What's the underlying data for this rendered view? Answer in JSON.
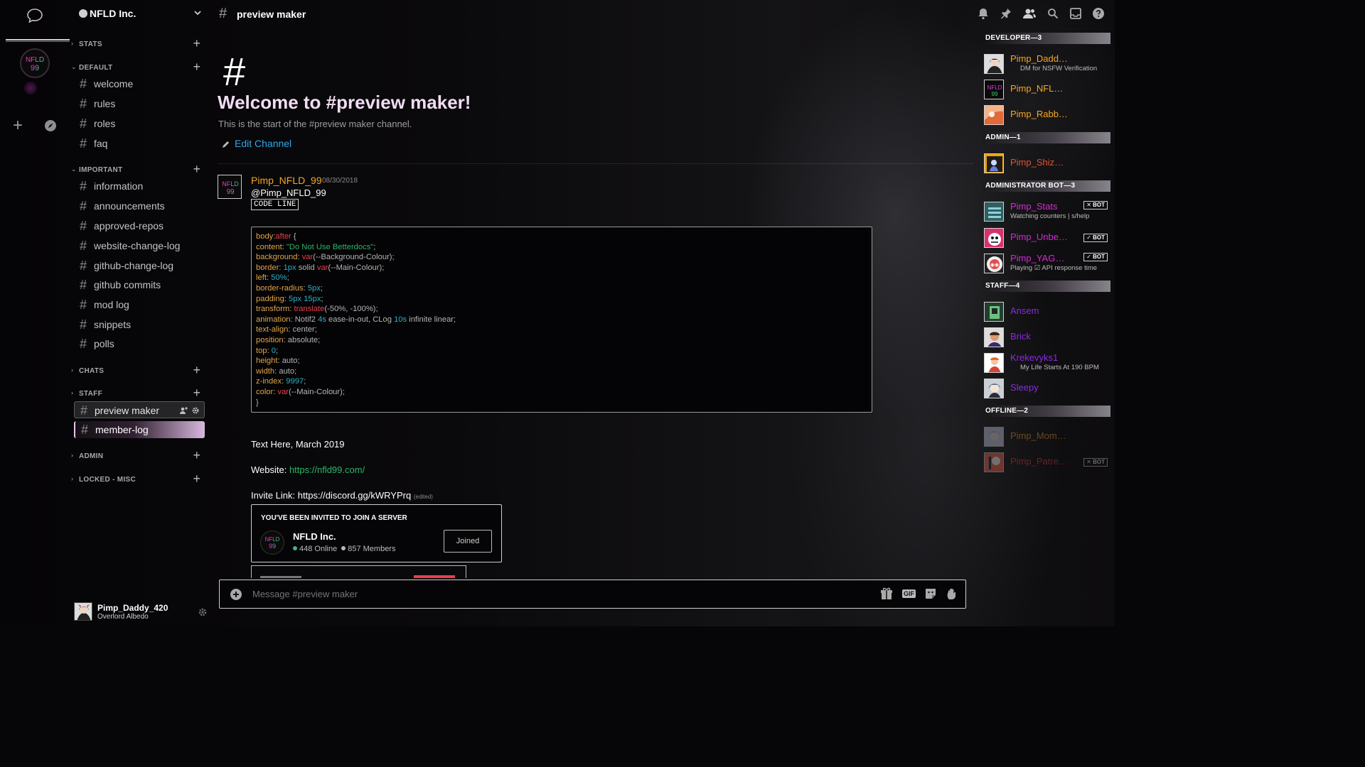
{
  "server": {
    "name": "NFLD Inc.",
    "icon_text_top": "NFLD",
    "icon_text_bottom": "99"
  },
  "sidebar": {
    "categories": [
      {
        "label": "STATS",
        "arrow": "›"
      },
      {
        "label": "DEFAULT",
        "arrow": "⌄"
      },
      {
        "label": "IMPORTANT",
        "arrow": "⌄"
      },
      {
        "label": "CHATS",
        "arrow": "›"
      },
      {
        "label": "STAFF",
        "arrow": "›"
      },
      {
        "label": "ADMIN",
        "arrow": "›"
      },
      {
        "label": "LOCKED - MISC",
        "arrow": "›"
      }
    ],
    "default_channels": [
      "welcome",
      "rules",
      "roles",
      "faq"
    ],
    "important_channels": [
      "information",
      "announcements",
      "approved-repos",
      "website-change-log",
      "github-change-log",
      "github commits",
      "mod log",
      "snippets",
      "polls"
    ],
    "staff_channels": [
      "preview maker",
      "member-log"
    ]
  },
  "user_panel": {
    "username": "Pimp_Daddy_420",
    "status": "Overlord Albedo"
  },
  "topbar": {
    "channel_name": "preview maker",
    "icons": [
      "bell-icon",
      "pin-icon",
      "members-icon",
      "search-icon",
      "inbox-icon",
      "help-icon"
    ]
  },
  "welcome": {
    "hash": "#",
    "title": "Welcome to #preview maker!",
    "subtitle": "This is the start of the #preview maker channel.",
    "edit_label": "Edit Channel"
  },
  "message": {
    "author": "Pimp_NFLD_99",
    "timestamp": "08/30/2018",
    "mention": "@Pimp_NFLD_99",
    "code_label": "CODE LINE",
    "code_lines": [
      [
        [
          "k",
          "body"
        ],
        [
          "p",
          ":"
        ],
        [
          "f",
          "after"
        ],
        [
          "p",
          " {"
        ]
      ],
      [
        [
          "k",
          "content"
        ],
        [
          "p",
          ": "
        ],
        [
          "s",
          "\"Do Not Use Betterdocs\""
        ],
        [
          "p",
          ";"
        ]
      ],
      [
        [
          "k",
          "background"
        ],
        [
          "p",
          ": "
        ],
        [
          "f",
          "var"
        ],
        [
          "p",
          "(--Background-Colour);"
        ]
      ],
      [
        [
          "k",
          "border"
        ],
        [
          "p",
          ": "
        ],
        [
          "n",
          "1px"
        ],
        [
          "p",
          " solid "
        ],
        [
          "f",
          "var"
        ],
        [
          "p",
          "(--Main-Colour);"
        ]
      ],
      [
        [
          "k",
          "left"
        ],
        [
          "p",
          ": "
        ],
        [
          "n",
          "50%"
        ],
        [
          "p",
          ";"
        ]
      ],
      [
        [
          "k",
          "border-radius"
        ],
        [
          "p",
          ": "
        ],
        [
          "n",
          "5px"
        ],
        [
          "p",
          ";"
        ]
      ],
      [
        [
          "k",
          "padding"
        ],
        [
          "p",
          ": "
        ],
        [
          "n",
          "5px 15px"
        ],
        [
          "p",
          ";"
        ]
      ],
      [
        [
          "k",
          "transform"
        ],
        [
          "p",
          ": "
        ],
        [
          "f",
          "translate"
        ],
        [
          "p",
          "(-50%, -100%);"
        ]
      ],
      [
        [
          "k",
          "animation"
        ],
        [
          "p",
          ": Notif2 "
        ],
        [
          "n",
          "4s"
        ],
        [
          "p",
          " ease-in-out, CLog "
        ],
        [
          "n",
          "10s"
        ],
        [
          "p",
          " infinite linear;"
        ]
      ],
      [
        [
          "k",
          "text-align"
        ],
        [
          "p",
          ": center;"
        ]
      ],
      [
        [
          "k",
          "position"
        ],
        [
          "p",
          ": absolute;"
        ]
      ],
      [
        [
          "k",
          "top"
        ],
        [
          "p",
          ": "
        ],
        [
          "n",
          "0"
        ],
        [
          "p",
          ";"
        ]
      ],
      [
        [
          "k",
          "height"
        ],
        [
          "p",
          ": auto;"
        ]
      ],
      [
        [
          "k",
          "width"
        ],
        [
          "p",
          ": auto;"
        ]
      ],
      [
        [
          "k",
          "z-index"
        ],
        [
          "p",
          ": "
        ],
        [
          "n",
          "9997"
        ],
        [
          "p",
          ";"
        ]
      ],
      [
        [
          "k",
          "color"
        ],
        [
          "p",
          ": "
        ],
        [
          "f",
          "var"
        ],
        [
          "p",
          "(--Main-Colour);"
        ]
      ],
      [
        [
          "p",
          "}"
        ]
      ]
    ],
    "text_here": "Text Here, March 2019",
    "website_label": "Website: ",
    "website_url": "https://nfld99.com/",
    "invite_label": "Invite Link: https://discord.gg/kWRYPrq",
    "edited": "(edited)"
  },
  "invite": {
    "heading": "YOU'VE BEEN INVITED TO JOIN A SERVER",
    "server_name": "NFLD Inc.",
    "online": "448 Online",
    "members": "857 Members",
    "button": "Joined"
  },
  "composer": {
    "placeholder": "Message #preview maker",
    "tools": [
      "gift-icon",
      "gif-button",
      "sticker-icon",
      "emoji-icon"
    ],
    "gif_label": "GIF"
  },
  "members": {
    "groups": [
      {
        "title": "DEVELOPER—3",
        "members": [
          {
            "name": "Pimp_Dadd…",
            "sub": "DM for NSFW Verification",
            "color": "#f5a623"
          },
          {
            "name": "Pimp_NFL…",
            "sub": "",
            "color": "#f5a623"
          },
          {
            "name": "Pimp_Rabb…",
            "sub": "",
            "color": "#f5a623"
          }
        ]
      },
      {
        "title": "ADMIN—1",
        "members": [
          {
            "name": "Pimp_Shiz…",
            "sub": "",
            "color": "#e0552d"
          }
        ]
      },
      {
        "title": "ADMINISTRATOR BOT—3",
        "members": [
          {
            "name": "Pimp_Stats",
            "sub": "Watching counters | s/help",
            "color": "#d52ad8",
            "bot": "✕ BOT"
          },
          {
            "name": "Pimp_Unbe…",
            "sub": "",
            "color": "#d52ad8",
            "bot": "✓ BOT"
          },
          {
            "name": "Pimp_YAG…",
            "sub": "Playing ☑ API response time",
            "color": "#d52ad8",
            "bot": "✓ BOT"
          }
        ]
      },
      {
        "title": "STAFF—4",
        "members": [
          {
            "name": "Ansem",
            "sub": "",
            "color": "#8a2be2"
          },
          {
            "name": "Brick",
            "sub": "",
            "color": "#8a2be2"
          },
          {
            "name": "Krekevyks1",
            "sub": "My Life Starts At 190 BPM",
            "color": "#8a2be2"
          },
          {
            "name": "Sleepy",
            "sub": "",
            "color": "#8a2be2"
          }
        ]
      },
      {
        "title": "OFFLINE—2",
        "members": [
          {
            "name": "Pimp_Mom…",
            "sub": "",
            "color": "#f5a623"
          },
          {
            "name": "Pimp_Patre…",
            "sub": "",
            "color": "#e8404c",
            "bot": "✕ BOT"
          }
        ]
      }
    ]
  }
}
